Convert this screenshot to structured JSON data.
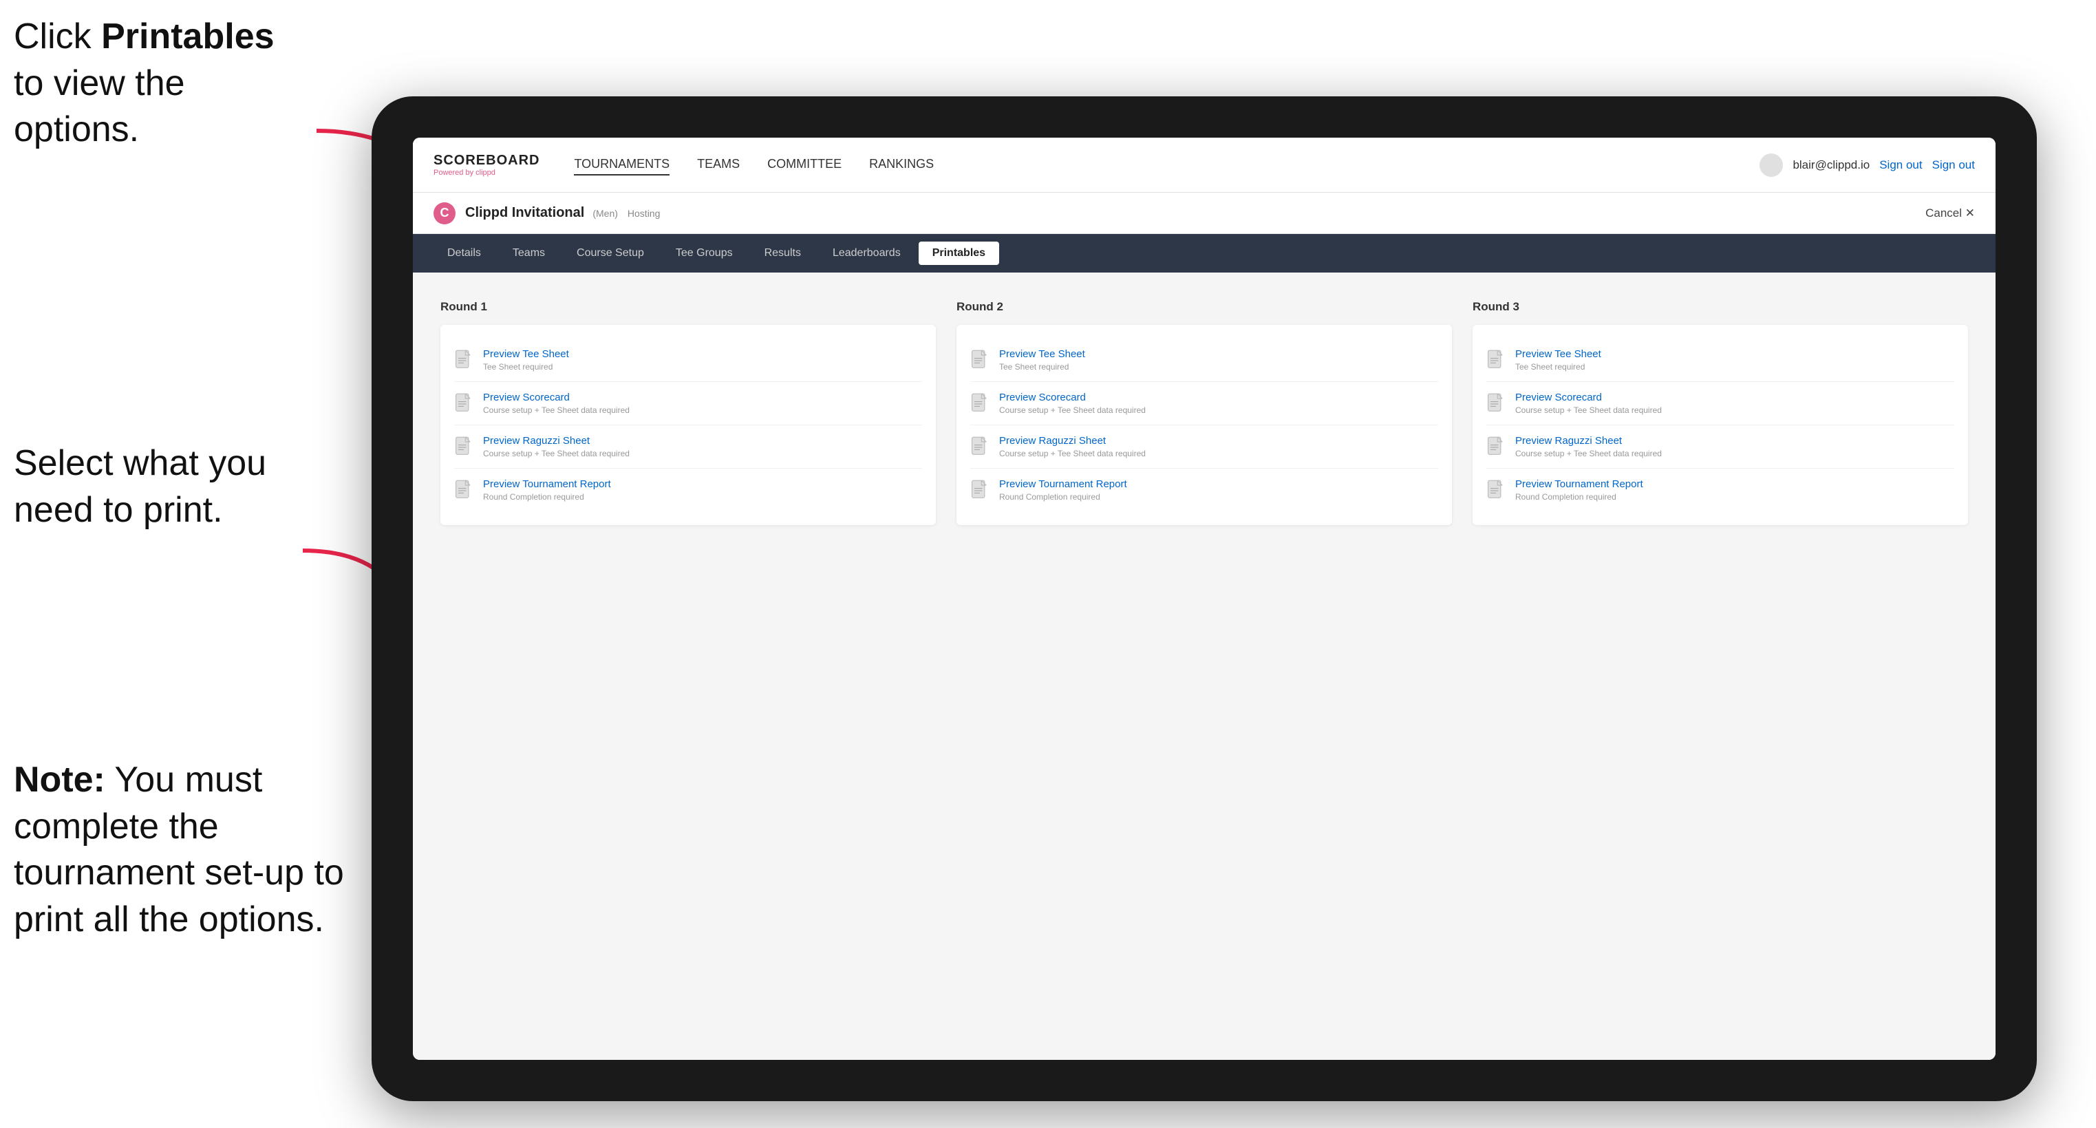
{
  "annotations": {
    "top": {
      "text_prefix": "Click ",
      "bold": "Printables",
      "text_suffix": " to view the options."
    },
    "mid": {
      "text": "Select what you need to print."
    },
    "bot": {
      "bold": "Note:",
      "text": " You must complete the tournament set-up to print all the options."
    }
  },
  "nav": {
    "logo_title": "SCOREBOARD",
    "logo_sub": "Powered by clippd",
    "links": [
      "TOURNAMENTS",
      "TEAMS",
      "COMMITTEE",
      "RANKINGS"
    ],
    "user_email": "blair@clippd.io",
    "sign_out": "Sign out"
  },
  "tournament": {
    "icon": "C",
    "name": "Clippd Invitational",
    "badge": "(Men)",
    "status": "Hosting",
    "cancel": "Cancel ✕"
  },
  "tabs": {
    "items": [
      "Details",
      "Teams",
      "Course Setup",
      "Tee Groups",
      "Results",
      "Leaderboards",
      "Printables"
    ],
    "active": "Printables"
  },
  "rounds": [
    {
      "title": "Round 1",
      "items": [
        {
          "title": "Preview Tee Sheet",
          "subtitle": "Tee Sheet required"
        },
        {
          "title": "Preview Scorecard",
          "subtitle": "Course setup + Tee Sheet data required"
        },
        {
          "title": "Preview Raguzzi Sheet",
          "subtitle": "Course setup + Tee Sheet data required"
        },
        {
          "title": "Preview Tournament Report",
          "subtitle": "Round Completion required"
        }
      ]
    },
    {
      "title": "Round 2",
      "items": [
        {
          "title": "Preview Tee Sheet",
          "subtitle": "Tee Sheet required"
        },
        {
          "title": "Preview Scorecard",
          "subtitle": "Course setup + Tee Sheet data required"
        },
        {
          "title": "Preview Raguzzi Sheet",
          "subtitle": "Course setup + Tee Sheet data required"
        },
        {
          "title": "Preview Tournament Report",
          "subtitle": "Round Completion required"
        }
      ]
    },
    {
      "title": "Round 3",
      "items": [
        {
          "title": "Preview Tee Sheet",
          "subtitle": "Tee Sheet required"
        },
        {
          "title": "Preview Scorecard",
          "subtitle": "Course setup + Tee Sheet data required"
        },
        {
          "title": "Preview Raguzzi Sheet",
          "subtitle": "Course setup + Tee Sheet data required"
        },
        {
          "title": "Preview Tournament Report",
          "subtitle": "Round Completion required"
        }
      ]
    }
  ]
}
